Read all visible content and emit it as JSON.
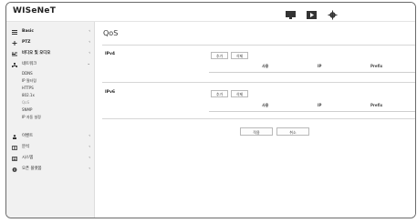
{
  "header": {
    "logo": "WISeNeT",
    "icons": [
      "monitor-icon",
      "play-icon",
      "gear-icon"
    ]
  },
  "sidebar": {
    "items": [
      {
        "label": "Basic",
        "icon": "grid-icon",
        "arrow": "‹"
      },
      {
        "label": "PTZ",
        "icon": "move-icon",
        "arrow": "‹"
      },
      {
        "label": "비디오 및 오디오",
        "icon": "video-icon",
        "arrow": "‹"
      },
      {
        "label": "네트워크",
        "icon": "network-icon",
        "arrow": "⌄"
      }
    ],
    "network_sub": [
      "DDNS",
      "IP 필터링",
      "HTTPS",
      "802.1x",
      "QoS",
      "SNMP",
      "IP 자동 설정"
    ],
    "items_after": [
      {
        "label": "이벤트",
        "icon": "person-icon",
        "arrow": "‹"
      },
      {
        "label": "분석",
        "icon": "analysis-icon",
        "arrow": "‹"
      },
      {
        "label": "시스템",
        "icon": "system-icon",
        "arrow": "‹"
      },
      {
        "label": "오픈 플랫폼",
        "icon": "platform-icon",
        "arrow": "‹"
      }
    ]
  },
  "main": {
    "title": "QoS",
    "ipv4": {
      "label": "IPv4",
      "add_label": "추가",
      "delete_label": "삭제",
      "columns": [
        "사용",
        "IP",
        "Prefix"
      ]
    },
    "ipv6": {
      "label": "IPv6",
      "add_label": "추가",
      "delete_label": "삭제",
      "columns": [
        "사용",
        "IP",
        "Prefix"
      ]
    },
    "apply_label": "적용",
    "cancel_label": "취소"
  }
}
